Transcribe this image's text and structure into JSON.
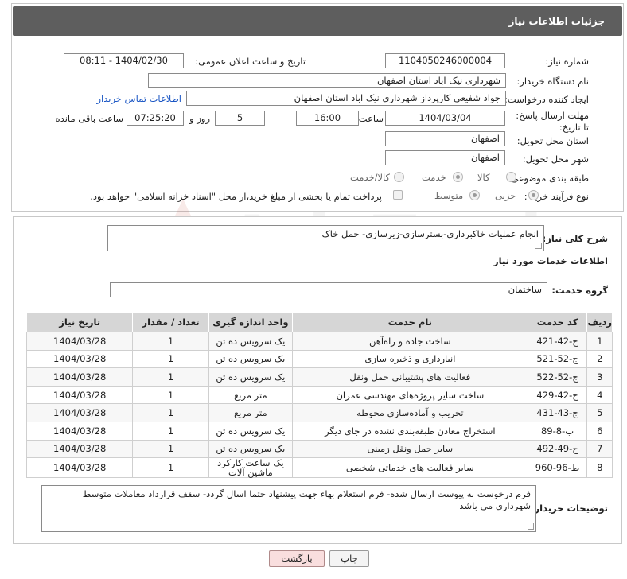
{
  "header": {
    "title": "جزئیات اطلاعات نیاز"
  },
  "fields": {
    "need_number_label": "شماره نیاز:",
    "need_number": "1104050246000004",
    "announce_label": "تاریخ و ساعت اعلان عمومی:",
    "announce_value": "1404/02/30 - 08:11",
    "buyer_org_label": "نام دستگاه خریدار:",
    "buyer_org": "شهرداری نیک اباد استان اصفهان",
    "creator_label": "ایجاد کننده درخواست:",
    "creator": "جواد شفیعی کارپرداز شهرداری نیک اباد استان اصفهان",
    "contact_link": "اطلاعات تماس خریدار",
    "deadline_label": "مهلت ارسال پاسخ: تا تاریخ:",
    "deadline_date": "1404/03/04",
    "time_label": "ساعت",
    "deadline_time": "16:00",
    "days_value": "5",
    "days_label": "روز و",
    "remaining_time": "07:25:20",
    "remaining_label": "ساعت باقی مانده",
    "province_label": "استان محل تحویل:",
    "province": "اصفهان",
    "city_label": "شهر محل تحویل:",
    "city": "اصفهان",
    "category_label": "طبقه بندی موضوعی:",
    "category_options": [
      "کالا",
      "خدمت",
      "کالا/خدمت"
    ],
    "category_selected": "خدمت",
    "process_label": "نوع فرآیند خرید :",
    "process_options": [
      "جزیی",
      "متوسط"
    ],
    "process_selected": "جزیی",
    "payment_note": "پرداخت تمام یا بخشی از مبلغ خرید،از محل \"اسناد خزانه اسلامی\" خواهد بود."
  },
  "details": {
    "general_desc_label": "شرح کلی نیاز:",
    "general_desc": "انجام عملیات خاکبرداری-بسترسازی-زیرسازی- حمل خاک",
    "services_title": "اطلاعات خدمات مورد نیاز",
    "service_group_label": "گروه خدمت:",
    "service_group": "ساختمان"
  },
  "table": {
    "headers": [
      "ردیف",
      "کد خدمت",
      "نام خدمت",
      "واحد اندازه گیری",
      "تعداد / مقدار",
      "تاریخ نیاز"
    ],
    "rows": [
      [
        "1",
        "ج-42-421",
        "ساخت جاده و راه‌آهن",
        "یک سرویس ده تن",
        "1",
        "1404/03/28"
      ],
      [
        "2",
        "ج-52-521",
        "انبارداری و ذخیره سازی",
        "یک سرویس ده تن",
        "1",
        "1404/03/28"
      ],
      [
        "3",
        "ج-52-522",
        "فعالیت های پشتیبانی حمل ونقل",
        "یک سرویس ده تن",
        "1",
        "1404/03/28"
      ],
      [
        "4",
        "ج-42-429",
        "ساخت سایر پروژه‌های مهندسی عمران",
        "متر مربع",
        "1",
        "1404/03/28"
      ],
      [
        "5",
        "ج-43-431",
        "تخریب و آماده‌سازی محوطه",
        "متر مربع",
        "1",
        "1404/03/28"
      ],
      [
        "6",
        "ب-8-89",
        "استخراج معادن طبقه‌بندی نشده در جای دیگر",
        "یک سرویس ده تن",
        "1",
        "1404/03/28"
      ],
      [
        "7",
        "ح-49-492",
        "سایر حمل ونقل زمینی",
        "یک سرویس ده تن",
        "1",
        "1404/03/28"
      ],
      [
        "8",
        "ط-96-960",
        "سایر فعالیت های خدماتی شخصی",
        "یک ساعت کارکرد ماشین آلات",
        "1",
        "1404/03/28"
      ]
    ]
  },
  "buyer_notes": {
    "label": "توضیحات خریدار:",
    "text": "فرم درخوست به پیوست ارسال شده- فرم استعلام بهاء جهت پیشنهاد حتما اسال گردد- سقف قرارداد معاملات متوسط شهرداری می باشد"
  },
  "buttons": {
    "print": "چاپ",
    "back": "بازگشت"
  },
  "watermark": {
    "text": "AriaTender.neT"
  },
  "colors": {
    "header_bg": "#5e5e5e",
    "link": "#1a56c4",
    "table_header_bg": "#d6d6d6",
    "back_button_bg": "#f9dede",
    "watermark": "#c0392b"
  }
}
